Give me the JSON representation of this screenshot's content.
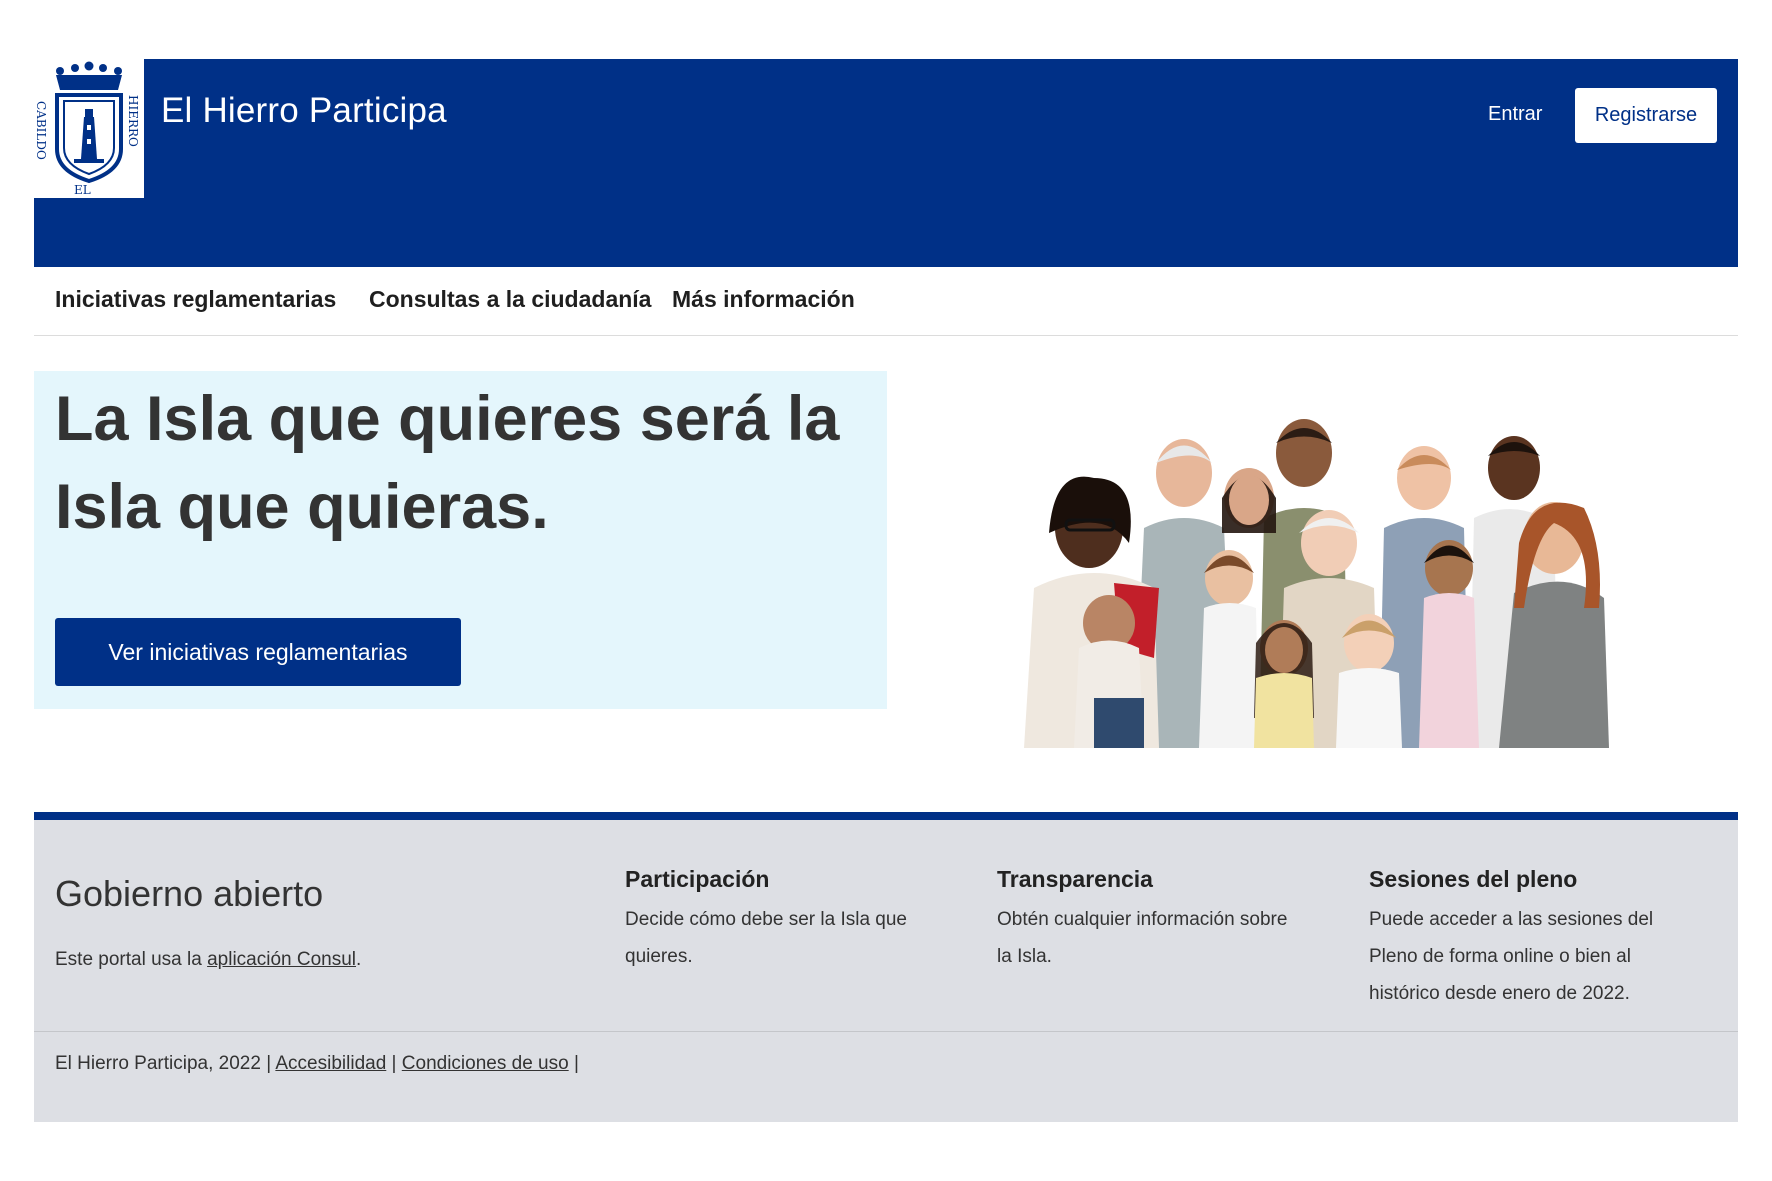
{
  "header": {
    "logo_text": "CABILDO EL HIERRO",
    "site_title": "El Hierro Participa",
    "login_label": "Entrar",
    "register_label": "Registrarse"
  },
  "nav": {
    "items": [
      {
        "label": "Iniciativas reglamentarias"
      },
      {
        "label": "Consultas a la ciudadanía"
      },
      {
        "label": "Más información"
      }
    ]
  },
  "hero": {
    "title": "La Isla que quieres será la Isla que quieras.",
    "button_label": "Ver iniciativas reglamentarias"
  },
  "footer": {
    "brand": "Gobierno abierto",
    "note_prefix": "Este portal usa la ",
    "note_link": "aplicación Consul",
    "note_suffix": ".",
    "columns": [
      {
        "title": "Participación",
        "text": "Decide cómo debe ser la Isla que quieres."
      },
      {
        "title": "Transparencia",
        "text": "Obtén cualquier información sobre la Isla."
      },
      {
        "title": "Sesiones del pleno",
        "text": "Puede acceder a las sesiones del Pleno de forma online o bien al histórico desde enero de 2022."
      }
    ],
    "bottom": {
      "copyright": "El Hierro Participa, 2022 | ",
      "accessibility": "Accesibilidad",
      "separator": " | ",
      "terms": "Condiciones de uso",
      "trailing": " |"
    }
  },
  "colors": {
    "brand_blue": "#003087",
    "hero_bg": "#e4f6fc",
    "footer_bg": "#dddfe4"
  }
}
